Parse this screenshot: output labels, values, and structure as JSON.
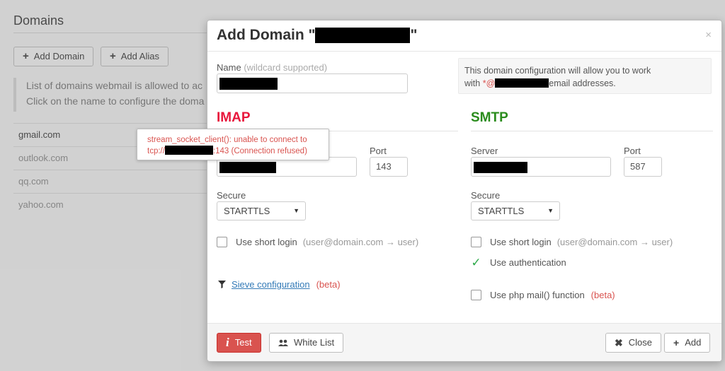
{
  "background": {
    "title": "Domains",
    "add_domain_label": "Add Domain",
    "add_alias_label": "Add Alias",
    "note_line1": "List of domains webmail is allowed to ac",
    "note_line2": "Click on the name to configure the doma",
    "domains": [
      "gmail.com",
      "outlook.com",
      "qq.com",
      "yahoo.com"
    ]
  },
  "modal": {
    "title_prefix": "Add Domain \"",
    "title_suffix": "\"",
    "close_glyph": "×",
    "name_label": "Name",
    "name_hint": "(wildcard supported)",
    "info_line1": "This domain configuration will allow you to work",
    "info_with": "with ",
    "info_wild": "*@",
    "info_suffix": "email addresses.",
    "imap": {
      "title": "IMAP",
      "port_label": "Port",
      "port_value": "143",
      "secure_label": "Secure",
      "secure_value": "STARTTLS",
      "short_login_label": "Use short login",
      "short_login_hint": "(user@domain.com → user)",
      "sieve_label": "Sieve configuration",
      "sieve_beta": "(beta)"
    },
    "smtp": {
      "title": "SMTP",
      "server_label": "Server",
      "port_label": "Port",
      "port_value": "587",
      "secure_label": "Secure",
      "secure_value": "STARTTLS",
      "short_login_label": "Use short login",
      "short_login_hint": "(user@domain.com → user)",
      "auth_label": "Use authentication",
      "phpmail_label": "Use php mail() function",
      "phpmail_beta": "(beta)"
    },
    "footer": {
      "test_label": "Test",
      "whitelist_label": "White List",
      "close_label": "Close",
      "add_label": "Add"
    },
    "tooltip": {
      "line1": "stream_socket_client(): unable to connect to",
      "line2_prefix": "tcp://",
      "line2_suffix": ":143 (Connection refused)"
    }
  },
  "colors": {
    "imap": "#e8173c",
    "smtp": "#2a8c1c",
    "danger": "#d9534f",
    "link": "#337ab7"
  }
}
